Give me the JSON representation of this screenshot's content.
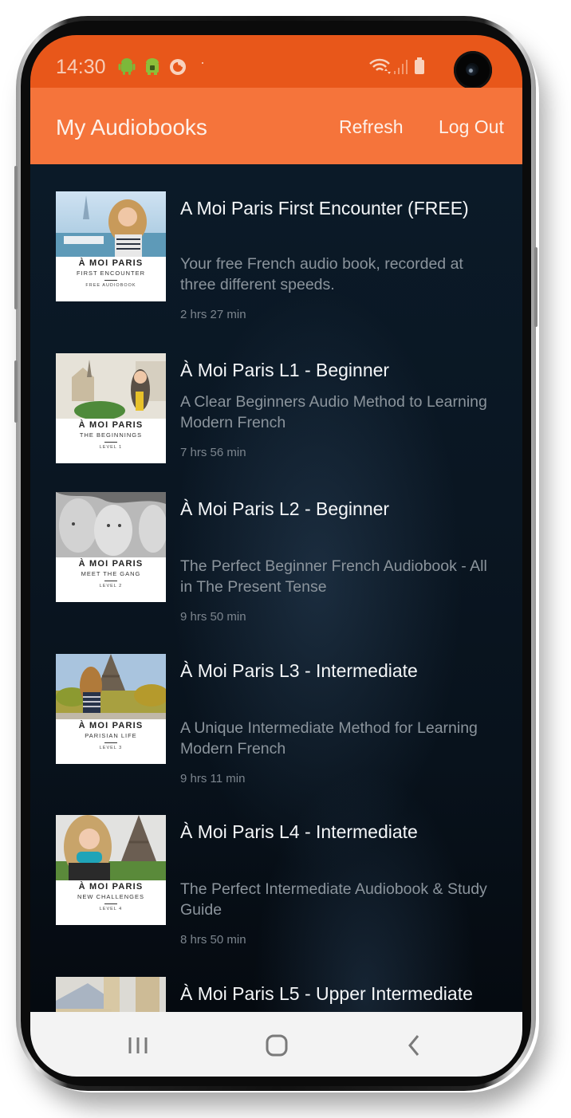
{
  "status_bar": {
    "time": "14:30",
    "left_icons": [
      "android-icon",
      "android-lock-icon",
      "firefox-icon",
      "dot-icon"
    ],
    "right_icons": [
      "wifi-icon",
      "signal-icon",
      "battery-icon"
    ]
  },
  "app_bar": {
    "title": "My Audiobooks",
    "actions": [
      {
        "label": "Refresh"
      },
      {
        "label": "Log Out"
      }
    ]
  },
  "colors": {
    "status_bar": "#e8571a",
    "app_bar": "#f5743b",
    "list_background": "#0a1622",
    "title_text": "#f4f6f8",
    "description_text": "#8b949c"
  },
  "audiobooks": [
    {
      "title": "A Moi Paris First Encounter (FREE)",
      "description": "Your free French audio book, recorded at three different speeds.",
      "duration": "2 hrs 27 min",
      "cover": {
        "brand": "À MOI PARIS",
        "subtitle": "FIRST ENCOUNTER",
        "footer": "FREE AUDIOBOOK"
      }
    },
    {
      "title": "À Moi Paris L1 - Beginner",
      "description": "A Clear Beginners Audio Method to Learning Modern French",
      "duration": "7 hrs 56 min",
      "cover": {
        "brand": "À MOI PARIS",
        "subtitle": "THE BEGINNINGS",
        "footer": "LEVEL 1"
      }
    },
    {
      "title": "À Moi Paris L2 - Beginner",
      "description": "The Perfect Beginner French Audiobook - All in The Present Tense",
      "duration": "9 hrs 50 min",
      "cover": {
        "brand": "À MOI PARIS",
        "subtitle": "MEET THE GANG",
        "footer": "LEVEL 2"
      }
    },
    {
      "title": "À Moi Paris L3 - Intermediate",
      "description": "A Unique Intermediate Method for Learning Modern French",
      "duration": "9 hrs 11 min",
      "cover": {
        "brand": "À MOI PARIS",
        "subtitle": "PARISIAN LIFE",
        "footer": "LEVEL 3"
      }
    },
    {
      "title": "À Moi Paris L4 - Intermediate",
      "description": "The Perfect Intermediate Audiobook & Study Guide",
      "duration": "8 hrs 50 min",
      "cover": {
        "brand": "À MOI PARIS",
        "subtitle": "NEW CHALLENGES",
        "footer": "LEVEL 4"
      }
    },
    {
      "title": "À Moi Paris L5 - Upper Intermediate",
      "description": "",
      "duration": "",
      "cover": {
        "brand": "",
        "subtitle": "",
        "footer": ""
      }
    }
  ],
  "nav_bar": {
    "buttons": [
      "recents-icon",
      "home-icon",
      "back-icon"
    ]
  }
}
